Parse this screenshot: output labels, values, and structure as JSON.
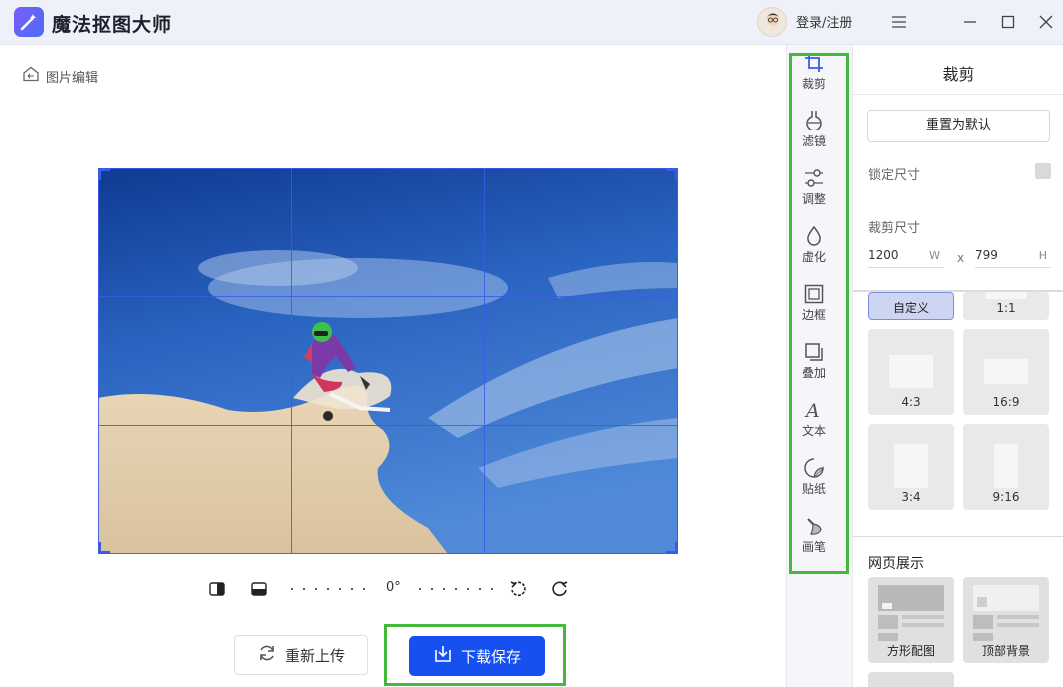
{
  "app": {
    "title": "魔法抠图大师",
    "login_label": "登录/注册"
  },
  "editor": {
    "back_label": "图片编辑",
    "angle_label": "0°",
    "reupload_label": "重新上传",
    "save_label": "下载保存"
  },
  "tools": [
    {
      "key": "crop",
      "label": "裁剪",
      "icon": "crop-icon"
    },
    {
      "key": "filter",
      "label": "滤镜",
      "icon": "flask-icon"
    },
    {
      "key": "adjust",
      "label": "调整",
      "icon": "sliders-icon"
    },
    {
      "key": "blur",
      "label": "虚化",
      "icon": "drop-icon"
    },
    {
      "key": "border",
      "label": "边框",
      "icon": "frame-icon"
    },
    {
      "key": "overlay",
      "label": "叠加",
      "icon": "overlay-icon"
    },
    {
      "key": "text",
      "label": "文本",
      "icon": "text-icon"
    },
    {
      "key": "sticker",
      "label": "贴纸",
      "icon": "sticker-icon"
    },
    {
      "key": "brush",
      "label": "画笔",
      "icon": "brush-icon"
    }
  ],
  "panel": {
    "title": "裁剪",
    "reset_label": "重置为默认",
    "lock_label": "锁定尺寸",
    "size_label": "裁剪尺寸",
    "width_value": "1200",
    "width_unit": "W",
    "times": "x",
    "height_value": "799",
    "height_unit": "H",
    "ratios": [
      "自定义",
      "1:1",
      "4:3",
      "16:9",
      "3:4",
      "9:16"
    ],
    "web_section_title": "网页展示",
    "web_items": [
      "方形配图",
      "顶部背景"
    ]
  },
  "colors": {
    "accent": "#1650f0",
    "highlight": "#46b83c",
    "grid": "#3b5be6"
  }
}
